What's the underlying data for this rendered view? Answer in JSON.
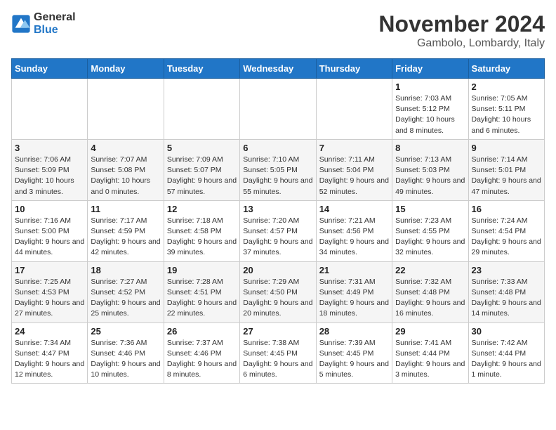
{
  "logo": {
    "line1": "General",
    "line2": "Blue"
  },
  "title": "November 2024",
  "location": "Gambolo, Lombardy, Italy",
  "weekdays": [
    "Sunday",
    "Monday",
    "Tuesday",
    "Wednesday",
    "Thursday",
    "Friday",
    "Saturday"
  ],
  "weeks": [
    [
      {
        "day": "",
        "info": ""
      },
      {
        "day": "",
        "info": ""
      },
      {
        "day": "",
        "info": ""
      },
      {
        "day": "",
        "info": ""
      },
      {
        "day": "",
        "info": ""
      },
      {
        "day": "1",
        "info": "Sunrise: 7:03 AM\nSunset: 5:12 PM\nDaylight: 10 hours and 8 minutes."
      },
      {
        "day": "2",
        "info": "Sunrise: 7:05 AM\nSunset: 5:11 PM\nDaylight: 10 hours and 6 minutes."
      }
    ],
    [
      {
        "day": "3",
        "info": "Sunrise: 7:06 AM\nSunset: 5:09 PM\nDaylight: 10 hours and 3 minutes."
      },
      {
        "day": "4",
        "info": "Sunrise: 7:07 AM\nSunset: 5:08 PM\nDaylight: 10 hours and 0 minutes."
      },
      {
        "day": "5",
        "info": "Sunrise: 7:09 AM\nSunset: 5:07 PM\nDaylight: 9 hours and 57 minutes."
      },
      {
        "day": "6",
        "info": "Sunrise: 7:10 AM\nSunset: 5:05 PM\nDaylight: 9 hours and 55 minutes."
      },
      {
        "day": "7",
        "info": "Sunrise: 7:11 AM\nSunset: 5:04 PM\nDaylight: 9 hours and 52 minutes."
      },
      {
        "day": "8",
        "info": "Sunrise: 7:13 AM\nSunset: 5:03 PM\nDaylight: 9 hours and 49 minutes."
      },
      {
        "day": "9",
        "info": "Sunrise: 7:14 AM\nSunset: 5:01 PM\nDaylight: 9 hours and 47 minutes."
      }
    ],
    [
      {
        "day": "10",
        "info": "Sunrise: 7:16 AM\nSunset: 5:00 PM\nDaylight: 9 hours and 44 minutes."
      },
      {
        "day": "11",
        "info": "Sunrise: 7:17 AM\nSunset: 4:59 PM\nDaylight: 9 hours and 42 minutes."
      },
      {
        "day": "12",
        "info": "Sunrise: 7:18 AM\nSunset: 4:58 PM\nDaylight: 9 hours and 39 minutes."
      },
      {
        "day": "13",
        "info": "Sunrise: 7:20 AM\nSunset: 4:57 PM\nDaylight: 9 hours and 37 minutes."
      },
      {
        "day": "14",
        "info": "Sunrise: 7:21 AM\nSunset: 4:56 PM\nDaylight: 9 hours and 34 minutes."
      },
      {
        "day": "15",
        "info": "Sunrise: 7:23 AM\nSunset: 4:55 PM\nDaylight: 9 hours and 32 minutes."
      },
      {
        "day": "16",
        "info": "Sunrise: 7:24 AM\nSunset: 4:54 PM\nDaylight: 9 hours and 29 minutes."
      }
    ],
    [
      {
        "day": "17",
        "info": "Sunrise: 7:25 AM\nSunset: 4:53 PM\nDaylight: 9 hours and 27 minutes."
      },
      {
        "day": "18",
        "info": "Sunrise: 7:27 AM\nSunset: 4:52 PM\nDaylight: 9 hours and 25 minutes."
      },
      {
        "day": "19",
        "info": "Sunrise: 7:28 AM\nSunset: 4:51 PM\nDaylight: 9 hours and 22 minutes."
      },
      {
        "day": "20",
        "info": "Sunrise: 7:29 AM\nSunset: 4:50 PM\nDaylight: 9 hours and 20 minutes."
      },
      {
        "day": "21",
        "info": "Sunrise: 7:31 AM\nSunset: 4:49 PM\nDaylight: 9 hours and 18 minutes."
      },
      {
        "day": "22",
        "info": "Sunrise: 7:32 AM\nSunset: 4:48 PM\nDaylight: 9 hours and 16 minutes."
      },
      {
        "day": "23",
        "info": "Sunrise: 7:33 AM\nSunset: 4:48 PM\nDaylight: 9 hours and 14 minutes."
      }
    ],
    [
      {
        "day": "24",
        "info": "Sunrise: 7:34 AM\nSunset: 4:47 PM\nDaylight: 9 hours and 12 minutes."
      },
      {
        "day": "25",
        "info": "Sunrise: 7:36 AM\nSunset: 4:46 PM\nDaylight: 9 hours and 10 minutes."
      },
      {
        "day": "26",
        "info": "Sunrise: 7:37 AM\nSunset: 4:46 PM\nDaylight: 9 hours and 8 minutes."
      },
      {
        "day": "27",
        "info": "Sunrise: 7:38 AM\nSunset: 4:45 PM\nDaylight: 9 hours and 6 minutes."
      },
      {
        "day": "28",
        "info": "Sunrise: 7:39 AM\nSunset: 4:45 PM\nDaylight: 9 hours and 5 minutes."
      },
      {
        "day": "29",
        "info": "Sunrise: 7:41 AM\nSunset: 4:44 PM\nDaylight: 9 hours and 3 minutes."
      },
      {
        "day": "30",
        "info": "Sunrise: 7:42 AM\nSunset: 4:44 PM\nDaylight: 9 hours and 1 minute."
      }
    ]
  ]
}
